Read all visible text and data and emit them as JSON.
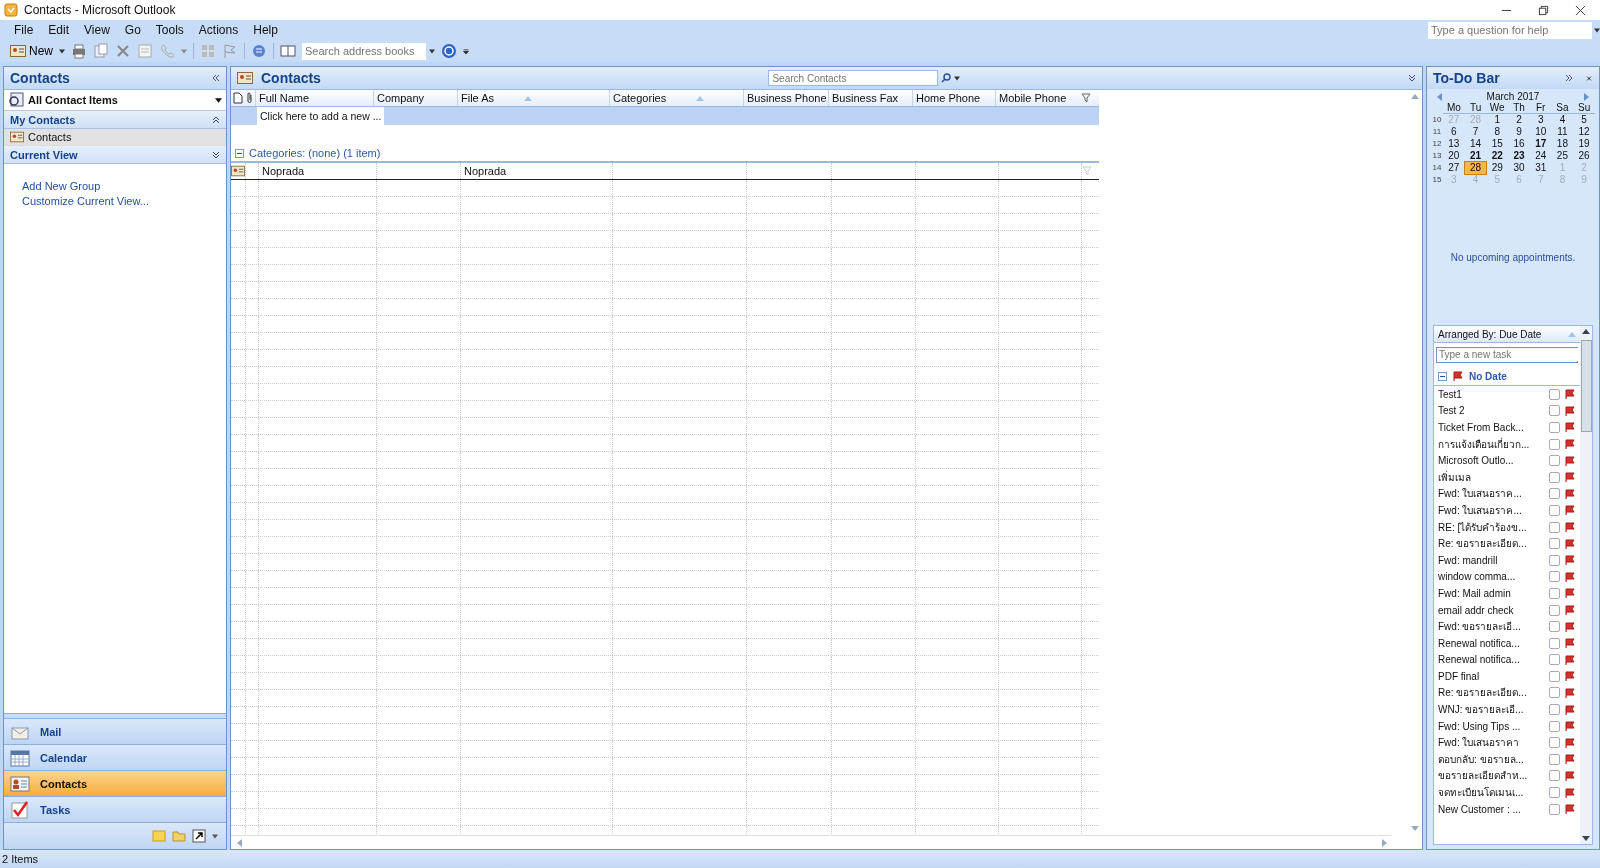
{
  "window": {
    "title": "Contacts - Microsoft Outlook"
  },
  "menu": [
    "File",
    "Edit",
    "View",
    "Go",
    "Tools",
    "Actions",
    "Help"
  ],
  "help_search": {
    "placeholder": "Type a question for help"
  },
  "toolbar": {
    "new_label": "New",
    "address_search": {
      "placeholder": "Search address books"
    }
  },
  "nav_pane": {
    "title": "Contacts",
    "view_selector": "All Contact Items",
    "sections": [
      {
        "title": "My Contacts",
        "expanded": true,
        "items": [
          {
            "label": "Contacts",
            "selected": true
          }
        ]
      },
      {
        "title": "Current View",
        "expanded": false
      }
    ],
    "links": [
      "Add New Group",
      "Customize Current View..."
    ],
    "buttons": [
      {
        "label": "Mail",
        "kind": "mail",
        "selected": false
      },
      {
        "label": "Calendar",
        "kind": "calendar",
        "selected": false
      },
      {
        "label": "Contacts",
        "kind": "contacts",
        "selected": true
      },
      {
        "label": "Tasks",
        "kind": "tasks",
        "selected": false
      }
    ]
  },
  "main": {
    "title": "Contacts",
    "search": {
      "placeholder": "Search Contacts"
    },
    "columns": [
      {
        "label": "Full Name",
        "sorted": false
      },
      {
        "label": "Company",
        "sorted": false
      },
      {
        "label": "File As",
        "sorted": true
      },
      {
        "label": "Categories",
        "sorted": true
      },
      {
        "label": "Business Phone",
        "sorted": false
      },
      {
        "label": "Business Fax",
        "sorted": false
      },
      {
        "label": "Home Phone",
        "sorted": false
      },
      {
        "label": "Mobile Phone",
        "sorted": false
      }
    ],
    "new_item": {
      "placeholder": "Click here to add a new ..."
    },
    "group": {
      "label": "Categories: (none) (1 item)",
      "expanded": true
    },
    "rows": [
      {
        "full_name": "Noprada",
        "file_as": "Noprada"
      }
    ]
  },
  "todo_bar": {
    "title": "To-Do Bar",
    "calendar": {
      "month": "March 2017",
      "weekdays": [
        "Mo",
        "Tu",
        "We",
        "Th",
        "Fr",
        "Sa",
        "Su"
      ],
      "weeks": [
        {
          "week": "10",
          "days": [
            {
              "d": "27",
              "muted": true,
              "bold": false,
              "selected": false
            },
            {
              "d": "28",
              "muted": true,
              "bold": false,
              "selected": false
            },
            {
              "d": "1",
              "muted": false,
              "bold": false,
              "selected": false
            },
            {
              "d": "2",
              "muted": false,
              "bold": false,
              "selected": false
            },
            {
              "d": "3",
              "muted": false,
              "bold": false,
              "selected": false
            },
            {
              "d": "4",
              "muted": false,
              "bold": false,
              "selected": false
            },
            {
              "d": "5",
              "muted": false,
              "bold": false,
              "selected": false
            }
          ]
        },
        {
          "week": "11",
          "days": [
            {
              "d": "6",
              "muted": false,
              "bold": false,
              "selected": false
            },
            {
              "d": "7",
              "muted": false,
              "bold": false,
              "selected": false
            },
            {
              "d": "8",
              "muted": false,
              "bold": false,
              "selected": false
            },
            {
              "d": "9",
              "muted": false,
              "bold": false,
              "selected": false
            },
            {
              "d": "10",
              "muted": false,
              "bold": false,
              "selected": false
            },
            {
              "d": "11",
              "muted": false,
              "bold": false,
              "selected": false
            },
            {
              "d": "12",
              "muted": false,
              "bold": false,
              "selected": false
            }
          ]
        },
        {
          "week": "12",
          "days": [
            {
              "d": "13",
              "muted": false,
              "bold": false,
              "selected": false
            },
            {
              "d": "14",
              "muted": false,
              "bold": false,
              "selected": false
            },
            {
              "d": "15",
              "muted": false,
              "bold": false,
              "selected": false
            },
            {
              "d": "16",
              "muted": false,
              "bold": false,
              "selected": false
            },
            {
              "d": "17",
              "muted": false,
              "bold": true,
              "selected": false
            },
            {
              "d": "18",
              "muted": false,
              "bold": false,
              "selected": false
            },
            {
              "d": "19",
              "muted": false,
              "bold": false,
              "selected": false
            }
          ]
        },
        {
          "week": "13",
          "days": [
            {
              "d": "20",
              "muted": false,
              "bold": false,
              "selected": false
            },
            {
              "d": "21",
              "muted": false,
              "bold": true,
              "selected": false
            },
            {
              "d": "22",
              "muted": false,
              "bold": true,
              "selected": false
            },
            {
              "d": "23",
              "muted": false,
              "bold": true,
              "selected": false
            },
            {
              "d": "24",
              "muted": false,
              "bold": false,
              "selected": false
            },
            {
              "d": "25",
              "muted": false,
              "bold": false,
              "selected": false
            },
            {
              "d": "26",
              "muted": false,
              "bold": false,
              "selected": false
            }
          ]
        },
        {
          "week": "14",
          "days": [
            {
              "d": "27",
              "muted": false,
              "bold": false,
              "selected": false
            },
            {
              "d": "28",
              "muted": false,
              "bold": false,
              "selected": true
            },
            {
              "d": "29",
              "muted": false,
              "bold": false,
              "selected": false
            },
            {
              "d": "30",
              "muted": false,
              "bold": false,
              "selected": false
            },
            {
              "d": "31",
              "muted": false,
              "bold": false,
              "selected": false
            },
            {
              "d": "1",
              "muted": true,
              "bold": false,
              "selected": false
            },
            {
              "d": "2",
              "muted": true,
              "bold": false,
              "selected": false
            }
          ]
        },
        {
          "week": "15",
          "days": [
            {
              "d": "3",
              "muted": true,
              "bold": false,
              "selected": false
            },
            {
              "d": "4",
              "muted": true,
              "bold": false,
              "selected": false
            },
            {
              "d": "5",
              "muted": true,
              "bold": false,
              "selected": false
            },
            {
              "d": "6",
              "muted": true,
              "bold": false,
              "selected": false
            },
            {
              "d": "7",
              "muted": true,
              "bold": false,
              "selected": false
            },
            {
              "d": "8",
              "muted": true,
              "bold": false,
              "selected": false
            },
            {
              "d": "9",
              "muted": true,
              "bold": false,
              "selected": false
            }
          ]
        }
      ]
    },
    "appointments": "No upcoming appointments.",
    "tasks": {
      "arranged_by": "Arranged By: Due Date",
      "new_task": {
        "placeholder": "Type a new task"
      },
      "group": "No Date",
      "items": [
        {
          "title": "Test1",
          "checked": false
        },
        {
          "title": "Test 2",
          "checked": false
        },
        {
          "title": "Ticket From Back...",
          "checked": false
        },
        {
          "title": "การแจ้งเตือนเกี่ยวก...",
          "checked": false
        },
        {
          "title": "Microsoft Outlo...",
          "checked": false
        },
        {
          "title": "เพิ่มเมล",
          "checked": false
        },
        {
          "title": "Fwd: ใบเสนอราค...",
          "checked": false
        },
        {
          "title": "Fwd: ใบเสนอราค...",
          "checked": false
        },
        {
          "title": "RE: [ได้รับคำร้องข...",
          "checked": false
        },
        {
          "title": "Re: ขอรายละเอียด...",
          "checked": false
        },
        {
          "title": "Fwd: mandrill",
          "checked": false
        },
        {
          "title": "window comma...",
          "checked": false
        },
        {
          "title": "Fwd: Mail admin",
          "checked": false
        },
        {
          "title": "email addr check",
          "checked": false
        },
        {
          "title": "Fwd: ขอรายละเอี...",
          "checked": false
        },
        {
          "title": "Renewal notifica...",
          "checked": false
        },
        {
          "title": "Renewal notifica...",
          "checked": false
        },
        {
          "title": "PDF final",
          "checked": false
        },
        {
          "title": "Re: ขอรายละเอียด...",
          "checked": false
        },
        {
          "title": "WNJ: ขอรายละเอี...",
          "checked": false
        },
        {
          "title": "Fwd: Using Tips ...",
          "checked": false
        },
        {
          "title": "Fwd: ใบเสนอราคา",
          "checked": false
        },
        {
          "title": "ตอบกลับ: ขอรายล...",
          "checked": false
        },
        {
          "title": "ขอรายละเอียดสำห...",
          "checked": false
        },
        {
          "title": "จดทะเบียนโดเมนเ...",
          "checked": false
        },
        {
          "title": "New Customer : ...",
          "checked": false
        }
      ]
    }
  },
  "status_bar": "2 Items"
}
